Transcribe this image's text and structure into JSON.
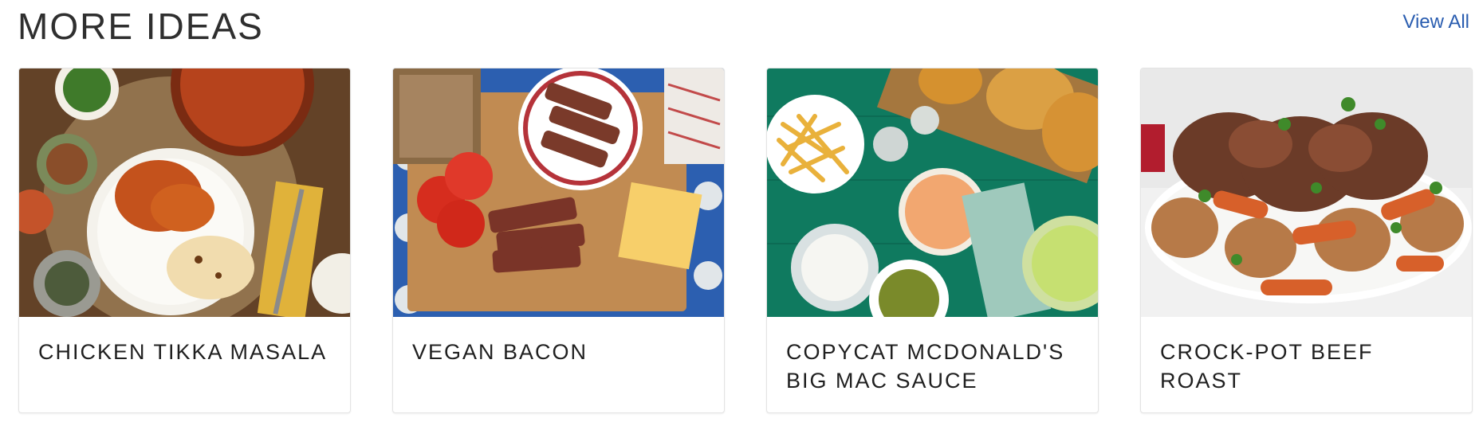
{
  "section": {
    "title": "MORE IDEAS",
    "view_all_label": "View All"
  },
  "cards": [
    {
      "title": "CHICKEN TIKKA MASALA",
      "image_icon": "chicken-tikka-masala-photo"
    },
    {
      "title": "VEGAN BACON",
      "image_icon": "vegan-bacon-photo"
    },
    {
      "title": "COPYCAT MCDONALD'S BIG MAC SAUCE",
      "image_icon": "big-mac-sauce-photo"
    },
    {
      "title": "CROCK-POT BEEF ROAST",
      "image_icon": "beef-roast-photo"
    }
  ],
  "colors": {
    "link": "#2a5db0",
    "title_text": "#2f2f2f"
  }
}
